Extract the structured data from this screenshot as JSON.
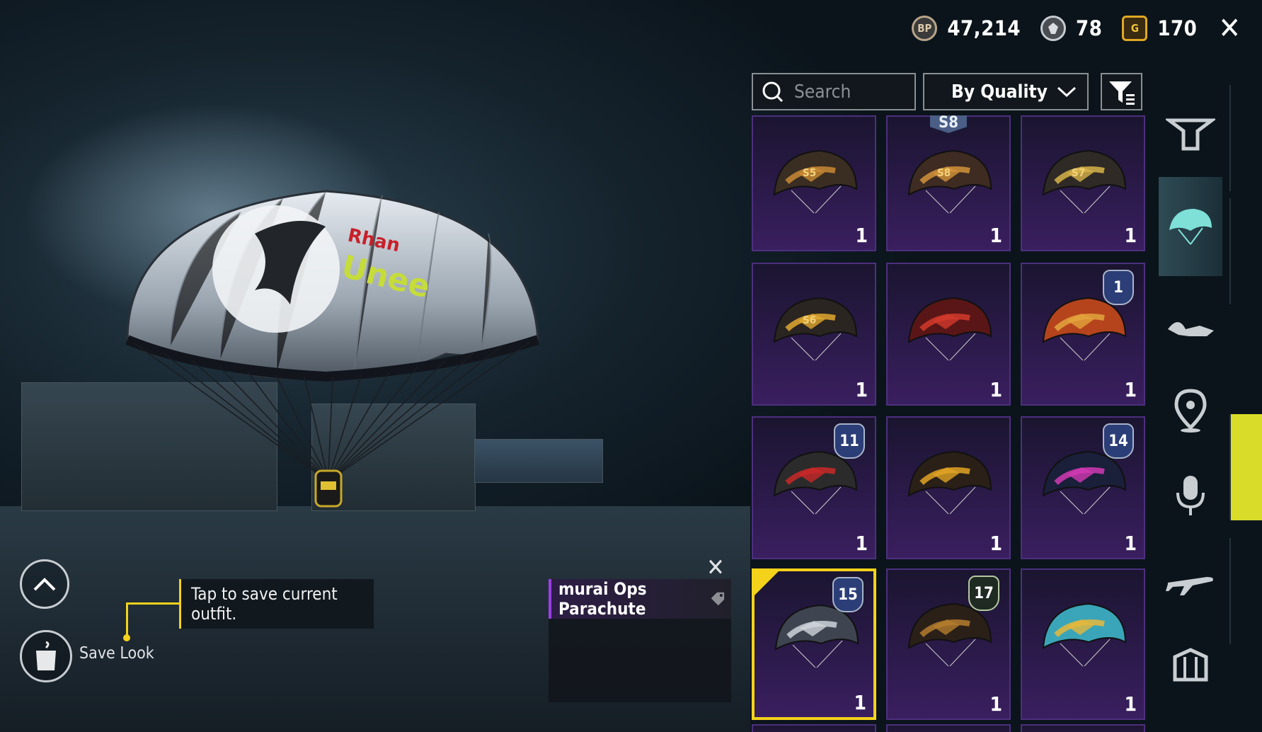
{
  "currency": {
    "bp": {
      "icon": "bp-coin-icon",
      "label": "BP",
      "value": "47,214"
    },
    "silver": {
      "icon": "silver-fragment-icon",
      "value": "78"
    },
    "gold": {
      "icon": "g-coin-icon",
      "label": "G",
      "value": "170"
    }
  },
  "search": {
    "placeholder": "Search"
  },
  "sort": {
    "selected": "By Quality"
  },
  "items": [
    {
      "count": "1",
      "emblem": "S5",
      "colors": [
        "#3a2d22",
        "#c98a34"
      ]
    },
    {
      "count": "1",
      "emblem": "S8",
      "season_tag": "S8",
      "colors": [
        "#3e2b22",
        "#d2933a"
      ]
    },
    {
      "count": "1",
      "emblem": "S7",
      "colors": [
        "#2f2a25",
        "#d7b34a"
      ]
    },
    {
      "count": "1",
      "emblem": "S6",
      "colors": [
        "#2a2520",
        "#e0a830"
      ]
    },
    {
      "count": "1",
      "colors": [
        "#5a1616",
        "#d23a2c"
      ]
    },
    {
      "count": "1",
      "badge": "1",
      "colors": [
        "#b5441c",
        "#e3a43c"
      ]
    },
    {
      "count": "1",
      "badge": "11",
      "colors": [
        "#2b2b2b",
        "#c92828"
      ]
    },
    {
      "count": "1",
      "colors": [
        "#2a2018",
        "#e0a324"
      ]
    },
    {
      "count": "1",
      "badge": "14",
      "colors": [
        "#1a1f3a",
        "#d23ab4"
      ]
    },
    {
      "count": "1",
      "badge": "15",
      "selected": true,
      "colors": [
        "#3e4550",
        "#cfd4da"
      ]
    },
    {
      "count": "1",
      "badge": "17",
      "colors": [
        "#2a2018",
        "#b47d2e"
      ]
    },
    {
      "count": "1",
      "colors": [
        "#3aa5b8",
        "#e6b83a"
      ]
    }
  ],
  "tooltip": {
    "text": "Tap to save current outfit."
  },
  "save_look": {
    "label": "Save Look"
  },
  "popup": {
    "title": "murai Ops Parachute"
  },
  "tabs": [
    "emote-icon",
    "parachute-icon",
    "pose-icon",
    "location-pin-icon",
    "microphone-icon",
    "airplane-icon",
    "crate-icon"
  ],
  "colors": {
    "accent": "#f4d21b",
    "rarity_purple": "#4c2f7e"
  }
}
